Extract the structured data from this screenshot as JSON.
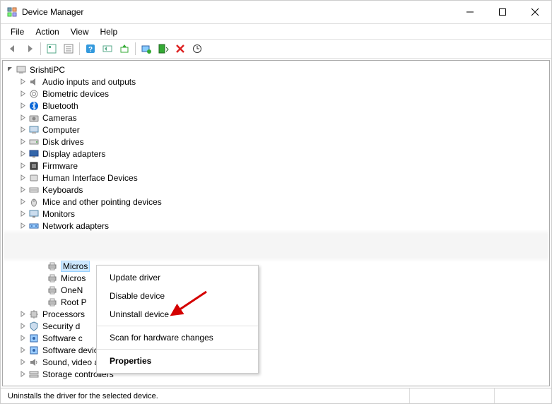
{
  "title": "Device Manager",
  "menus": {
    "file": "File",
    "action": "Action",
    "view": "View",
    "help": "Help"
  },
  "root_computer": "SrishtiPC",
  "categories": [
    {
      "label": "Audio inputs and outputs",
      "icon": "speaker"
    },
    {
      "label": "Biometric devices",
      "icon": "fingerprint"
    },
    {
      "label": "Bluetooth",
      "icon": "bluetooth"
    },
    {
      "label": "Cameras",
      "icon": "camera"
    },
    {
      "label": "Computer",
      "icon": "computer"
    },
    {
      "label": "Disk drives",
      "icon": "disk"
    },
    {
      "label": "Display adapters",
      "icon": "display"
    },
    {
      "label": "Firmware",
      "icon": "firmware"
    },
    {
      "label": "Human Interface Devices",
      "icon": "hid"
    },
    {
      "label": "Keyboards",
      "icon": "keyboard"
    },
    {
      "label": "Mice and other pointing devices",
      "icon": "mouse"
    },
    {
      "label": "Monitors",
      "icon": "monitor"
    },
    {
      "label": "Network adapters",
      "icon": "network"
    }
  ],
  "printer_children": [
    {
      "label": "Micros",
      "selected": true
    },
    {
      "label": "Micros",
      "selected": false
    },
    {
      "label": "OneN",
      "selected": false
    },
    {
      "label": "Root P",
      "selected": false
    }
  ],
  "categories_after": [
    {
      "label": "Processors",
      "icon": "cpu",
      "cut": true
    },
    {
      "label": "Security d",
      "icon": "security",
      "cut": true
    },
    {
      "label": "Software c",
      "icon": "software",
      "cut": true
    },
    {
      "label": "Software devices",
      "icon": "software",
      "cut": false
    },
    {
      "label": "Sound, video and game controllers",
      "icon": "sound",
      "cut": false
    },
    {
      "label": "Storage controllers",
      "icon": "storage",
      "cut": false
    }
  ],
  "context_menu": {
    "update": "Update driver",
    "disable": "Disable device",
    "uninstall": "Uninstall device",
    "scan": "Scan for hardware changes",
    "properties": "Properties"
  },
  "status_text": "Uninstalls the driver for the selected device."
}
